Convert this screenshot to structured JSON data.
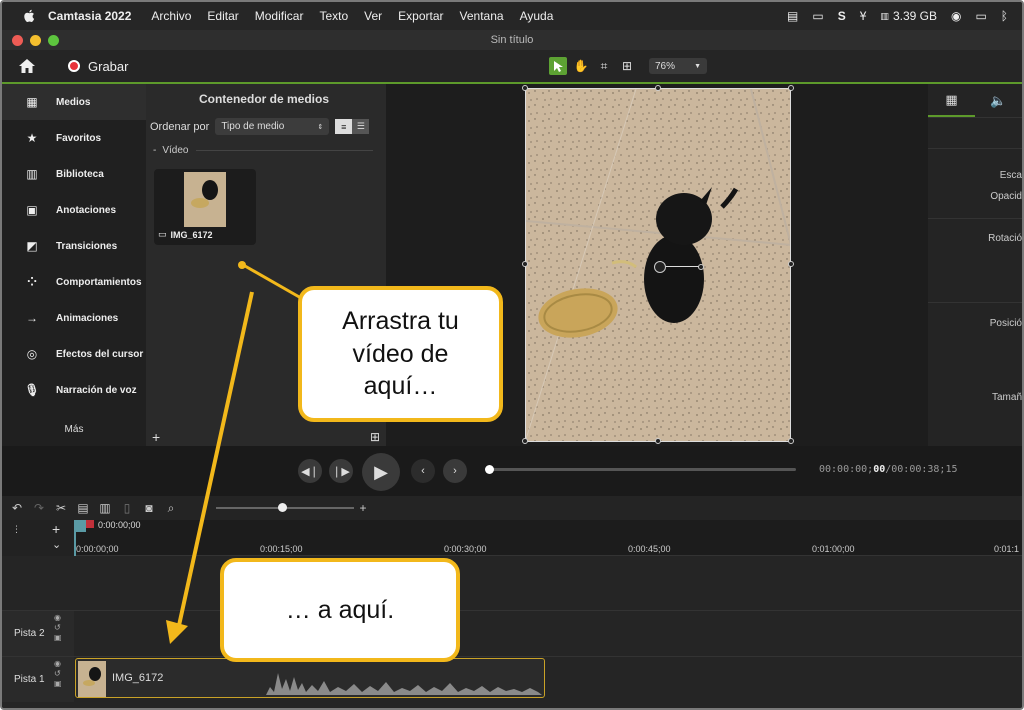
{
  "menubar": {
    "app": "Camtasia 2022",
    "items": [
      "Archivo",
      "Editar",
      "Modificar",
      "Texto",
      "Ver",
      "Exportar",
      "Ventana",
      "Ayuda"
    ],
    "memory": "3.39 GB"
  },
  "window": {
    "title": "Sin título"
  },
  "toolbar": {
    "record_label": "Grabar",
    "zoom": "76%"
  },
  "sidebar": {
    "items": [
      {
        "label": "Medios",
        "icon": "film-icon"
      },
      {
        "label": "Favoritos",
        "icon": "star-icon"
      },
      {
        "label": "Biblioteca",
        "icon": "library-icon"
      },
      {
        "label": "Anotaciones",
        "icon": "annotation-icon"
      },
      {
        "label": "Transiciones",
        "icon": "transition-icon"
      },
      {
        "label": "Comportamientos",
        "icon": "behavior-icon"
      },
      {
        "label": "Animaciones",
        "icon": "animation-icon"
      },
      {
        "label": "Efectos del cursor",
        "icon": "cursor-effect-icon"
      },
      {
        "label": "Narración de voz",
        "icon": "microphone-icon"
      }
    ],
    "more": "Más"
  },
  "media_bin": {
    "title": "Contenedor de medios",
    "sort_label": "Ordenar por",
    "sort_value": "Tipo de medio",
    "section": "Vídeo",
    "items": [
      {
        "name": "IMG_6172"
      }
    ]
  },
  "properties": {
    "labels": [
      "Esca",
      "Opacid",
      "Rotació",
      "Posició",
      "Tamañ"
    ]
  },
  "playback": {
    "time_current": "00:00:00;",
    "time_frame": "00",
    "time_total": "/00:00:38;15"
  },
  "timeline": {
    "playhead_time": "0:00:00;00",
    "ruler_labels": [
      "0:00:00;00",
      "0:00:15;00",
      "0:00:30;00",
      "0:00:45;00",
      "0:01:00;00",
      "0:01:1"
    ],
    "tracks": [
      "Pista 2",
      "Pista 1"
    ],
    "clip": {
      "name": "IMG_6172"
    }
  },
  "callouts": {
    "top": "Arrastra tu vídeo de aquí…",
    "bottom": "… a aquí."
  },
  "colors": {
    "accent": "#5d9a2b",
    "callout_border": "#f2b81b",
    "record": "#e8333a"
  }
}
